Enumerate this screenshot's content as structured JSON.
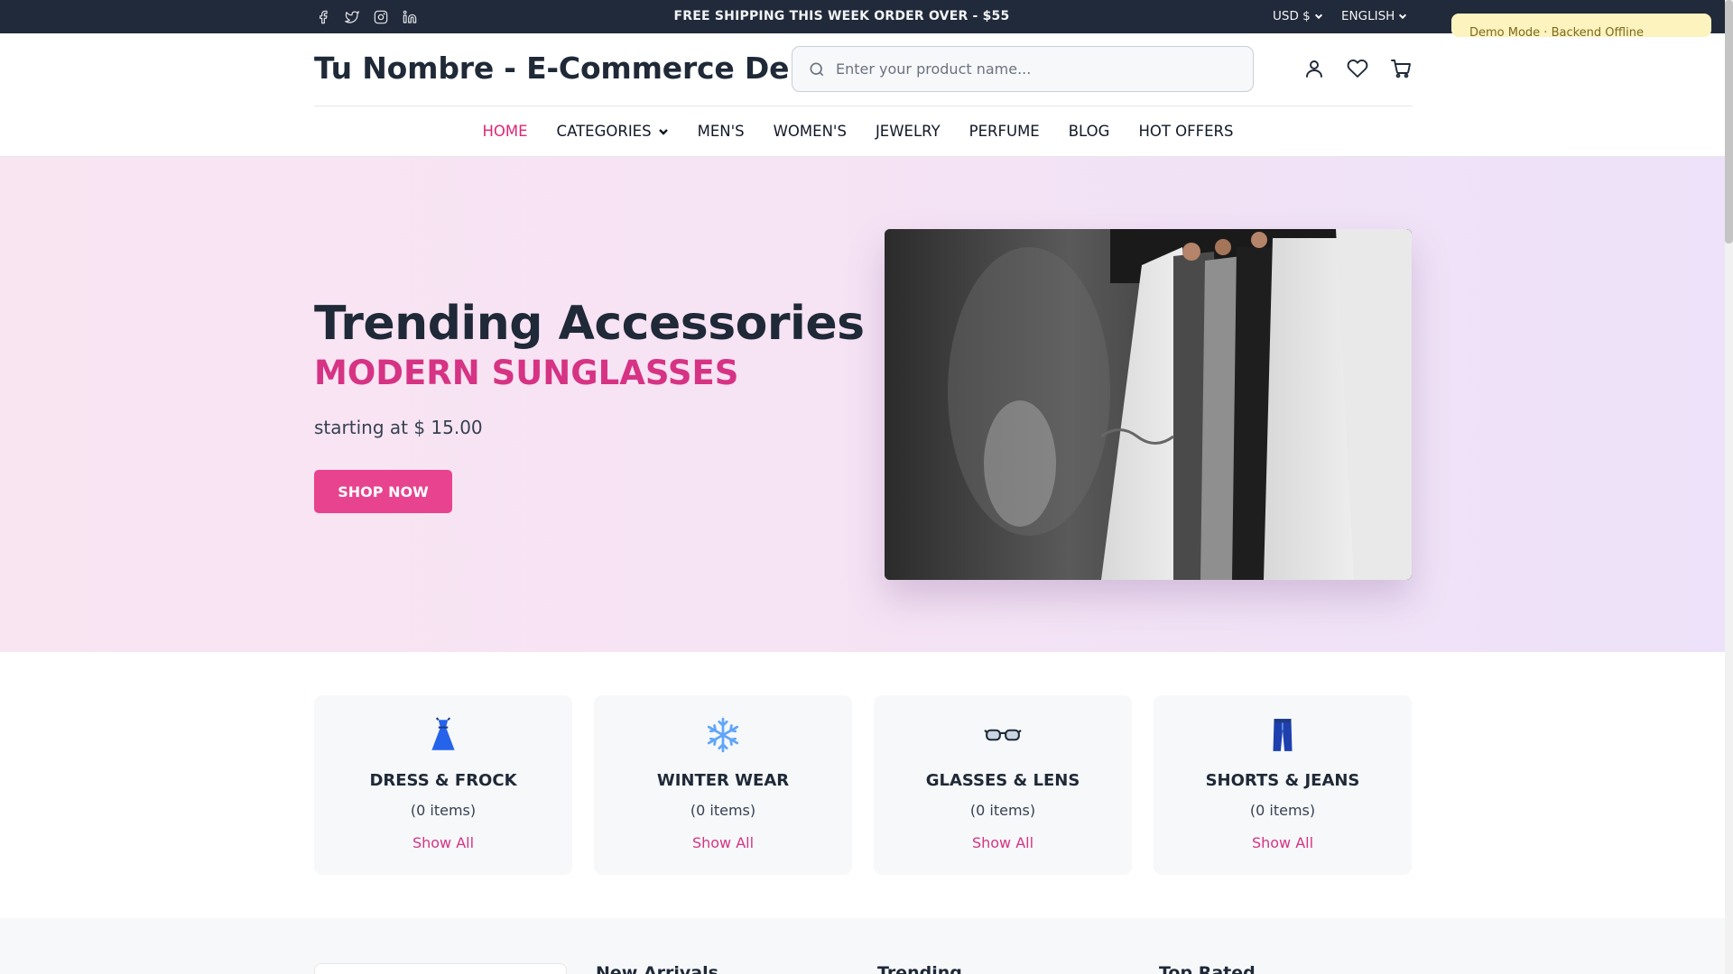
{
  "topbar": {
    "social": [
      "facebook-icon",
      "twitter-icon",
      "instagram-icon",
      "linkedin-icon"
    ],
    "shipping_text": "FREE SHIPPING THIS WEEK ORDER OVER - $55",
    "currency": "USD $",
    "language": "ENGLISH",
    "demo_notice": "Demo Mode · Backend Offline"
  },
  "header": {
    "brand": "Tu Nombre - E-Commerce Demo",
    "search_placeholder": "Enter your product name...",
    "icons": [
      "user-icon",
      "heart-icon",
      "cart-icon"
    ]
  },
  "nav": {
    "items": [
      "HOME",
      "CATEGORIES",
      "MEN'S",
      "WOMEN'S",
      "JEWELRY",
      "PERFUME",
      "BLOG",
      "HOT OFFERS"
    ],
    "active": "HOME"
  },
  "hero": {
    "title": "Trending Accessories",
    "subtitle": "MODERN SUNGLASSES",
    "price_text": "starting at $ 15.00",
    "button_label": "SHOP NOW"
  },
  "categories": [
    {
      "name": "DRESS & FROCK",
      "count": "(0 items)",
      "link": "Show All",
      "icon": "dress-icon"
    },
    {
      "name": "WINTER WEAR",
      "count": "(0 items)",
      "link": "Show All",
      "icon": "snowflake-icon"
    },
    {
      "name": "GLASSES & LENS",
      "count": "(0 items)",
      "link": "Show All",
      "icon": "glasses-icon"
    },
    {
      "name": "SHORTS & JEANS",
      "count": "(0 items)",
      "link": "Show All",
      "icon": "jeans-icon"
    }
  ],
  "sections": {
    "new_arrivals": "New Arrivals",
    "trending": "Trending",
    "top_rated": "Top Rated"
  },
  "colors": {
    "accent": "#e8438e",
    "accent_text": "#d63384",
    "topbar": "#212a3a"
  }
}
